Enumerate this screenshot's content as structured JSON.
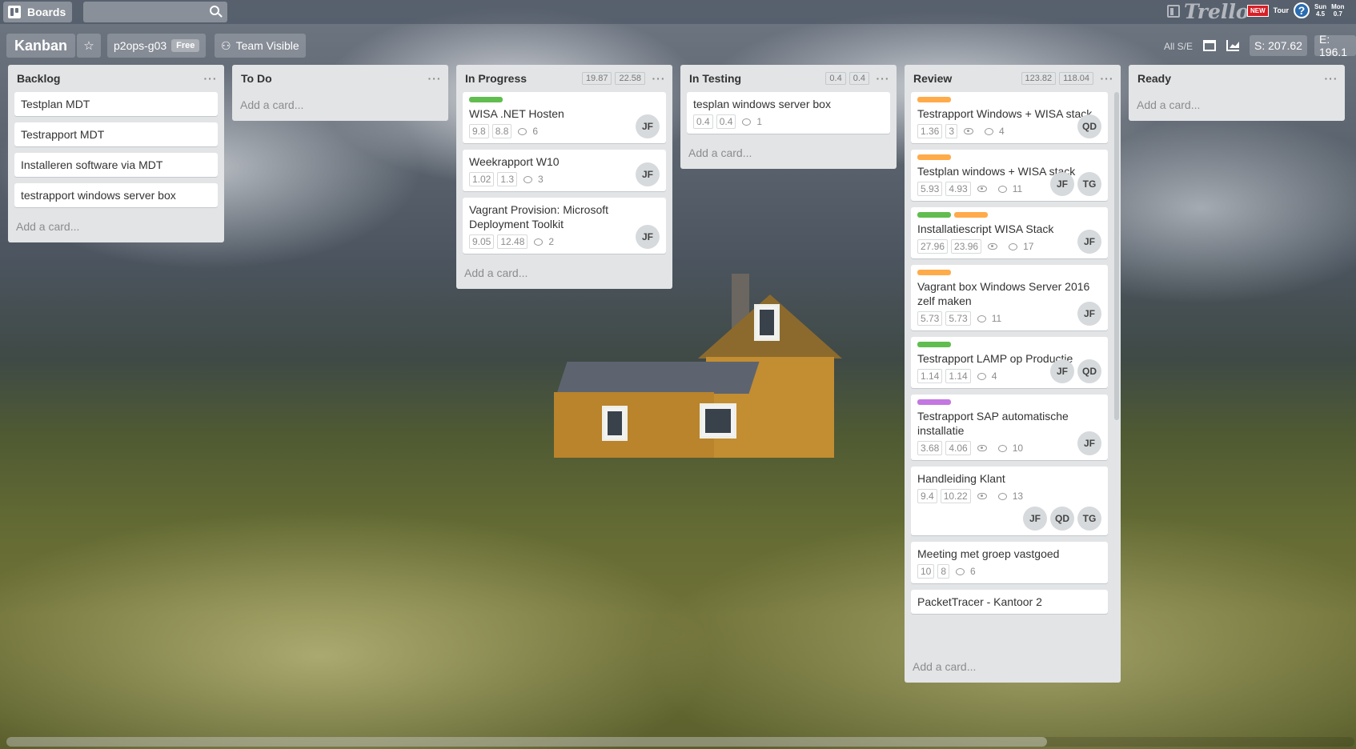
{
  "topbar": {
    "boards_label": "Boards",
    "search_placeholder": "",
    "logo_text": "Trello",
    "new_badge": "NEW",
    "tour_label": "Tour",
    "days": [
      {
        "day": "Sun",
        "value": "4.5"
      },
      {
        "day": "Mon",
        "value": "0.7"
      }
    ]
  },
  "board": {
    "title": "Kanban",
    "org_name": "p2ops-g03",
    "org_plan": "Free",
    "visibility": "Team Visible",
    "filter_label": "All S/E",
    "stat_s": "S: 207.62",
    "stat_e": "E: 196.1"
  },
  "lists": [
    {
      "title": "Backlog",
      "badges": [],
      "cards": [
        {
          "title": "Testplan MDT"
        },
        {
          "title": "Testrapport MDT"
        },
        {
          "title": "Installeren software via MDT"
        },
        {
          "title": "testrapport windows server box"
        }
      ],
      "add_card": "Add a card..."
    },
    {
      "title": "To Do",
      "badges": [],
      "cards": [],
      "add_card": "Add a card..."
    },
    {
      "title": "In Progress",
      "badges": [
        "19.87",
        "22.58"
      ],
      "cards": [
        {
          "labels": [
            "#61bd4f"
          ],
          "title": "WISA .NET Hosten",
          "s": "9.8",
          "e": "8.8",
          "watch": false,
          "comments": "6",
          "members": [
            "JF"
          ]
        },
        {
          "labels": [],
          "title": "Weekrapport W10",
          "s": "1.02",
          "e": "1.3",
          "watch": false,
          "comments": "3",
          "members": [
            "JF"
          ]
        },
        {
          "labels": [],
          "title": "Vagrant Provision: Microsoft Deployment Toolkit",
          "s": "9.05",
          "e": "12.48",
          "watch": false,
          "comments": "2",
          "members": [
            "JF"
          ]
        }
      ],
      "add_card": "Add a card..."
    },
    {
      "title": "In Testing",
      "badges": [
        "0.4",
        "0.4"
      ],
      "cards": [
        {
          "labels": [],
          "title": "tesplan windows server box",
          "s": "0.4",
          "e": "0.4",
          "watch": false,
          "comments": "1",
          "members": []
        }
      ],
      "add_card": "Add a card..."
    },
    {
      "title": "Review",
      "badges": [
        "123.82",
        "118.04"
      ],
      "cards": [
        {
          "labels": [
            "#ffab4a"
          ],
          "title": "Testrapport Windows + WISA stack",
          "s": "1.36",
          "e": "3",
          "watch": true,
          "comments": "4",
          "members": [
            "QD"
          ]
        },
        {
          "labels": [
            "#ffab4a"
          ],
          "title": "Testplan windows + WISA stack",
          "s": "5.93",
          "e": "4.93",
          "watch": true,
          "comments": "11",
          "members": [
            "JF",
            "TG"
          ]
        },
        {
          "labels": [
            "#61bd4f",
            "#ffab4a"
          ],
          "title": "Installatiescript WISA Stack",
          "s": "27.96",
          "e": "23.96",
          "watch": true,
          "comments": "17",
          "members": [
            "JF"
          ]
        },
        {
          "labels": [
            "#ffab4a"
          ],
          "title": "Vagrant box Windows Server 2016 zelf maken",
          "s": "5.73",
          "e": "5.73",
          "watch": false,
          "comments": "11",
          "members": [
            "JF"
          ]
        },
        {
          "labels": [
            "#61bd4f"
          ],
          "title": "Testrapport LAMP op Productie",
          "s": "1.14",
          "e": "1.14",
          "watch": false,
          "comments": "4",
          "members": [
            "JF",
            "QD"
          ]
        },
        {
          "labels": [
            "#c377e0"
          ],
          "title": "Testrapport SAP automatische installatie",
          "s": "3.68",
          "e": "4.06",
          "watch": true,
          "comments": "10",
          "members": [
            "JF"
          ]
        },
        {
          "labels": [],
          "title": "Handleiding Klant",
          "s": "9.4",
          "e": "10.22",
          "watch": true,
          "comments": "13",
          "members": [
            "JF",
            "QD",
            "TG"
          ]
        },
        {
          "labels": [],
          "title": "Meeting met groep vastgoed",
          "s": "10",
          "e": "8",
          "watch": false,
          "comments": "6",
          "members": []
        },
        {
          "labels": [],
          "title": "PacketTracer - Kantoor 2",
          "s": "",
          "e": "",
          "watch": false,
          "comments": "",
          "members": []
        }
      ],
      "add_card": "Add a card..."
    },
    {
      "title": "Ready",
      "badges": [],
      "cards": [],
      "add_card": "Add a card..."
    }
  ]
}
